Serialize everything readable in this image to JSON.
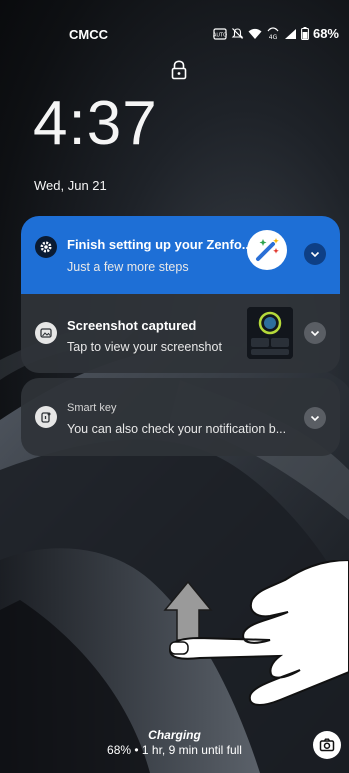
{
  "status_bar": {
    "carrier": "CMCC",
    "icons": [
      "auto-brightness-icon",
      "mute-icon",
      "wifi-icon",
      "volte-icon",
      "signal-icon",
      "battery-icon"
    ],
    "battery_percent": "68%"
  },
  "lockscreen": {
    "time": "4:37",
    "date": "Wed, Jun 21"
  },
  "notifications": [
    {
      "icon": "gear-icon",
      "title": "Finish setting up your Zenfo...",
      "text": "Just a few more steps",
      "accent": "#1e6fd6"
    },
    {
      "icon": "screenshot-icon",
      "title": "Screenshot captured",
      "text": "Tap to view your screenshot"
    },
    {
      "icon": "smart-key-icon",
      "app": "Smart key",
      "text": "You can also check your notification b..."
    }
  ],
  "charging": {
    "title": "Charging",
    "detail": "68% • 1 hr, 9 min until full"
  },
  "shortcut": {
    "icon": "camera-icon"
  }
}
